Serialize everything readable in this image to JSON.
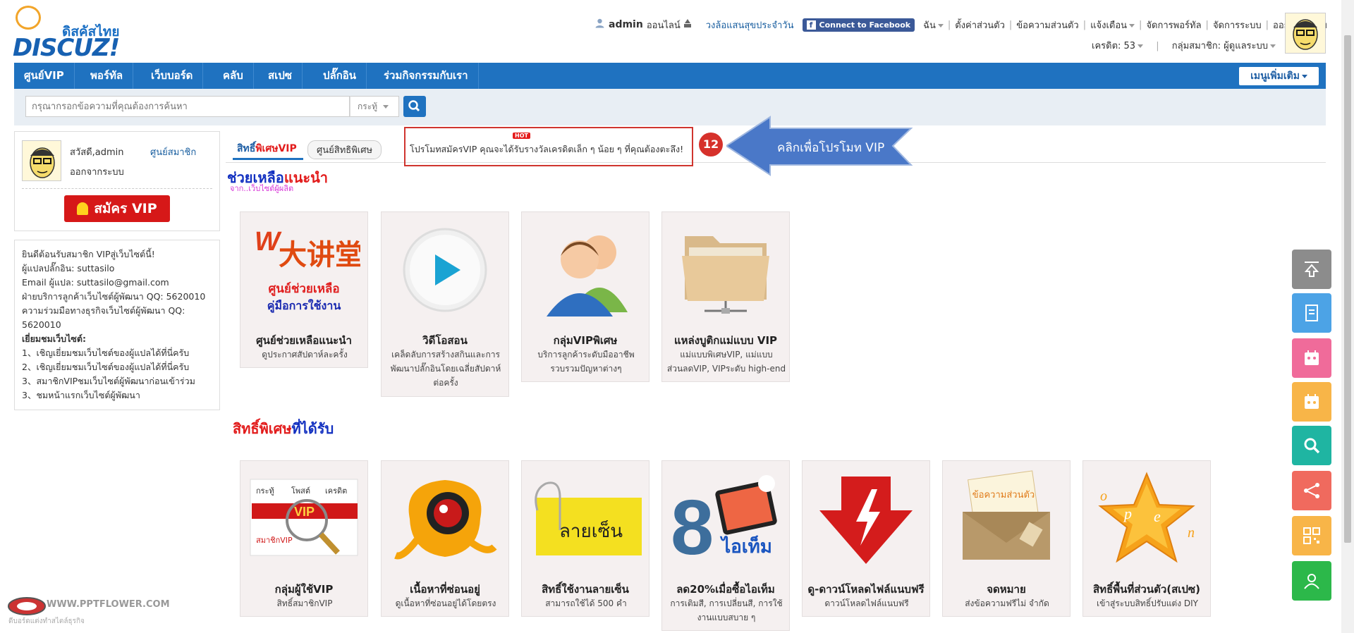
{
  "logo": {
    "thai": "ดิสคัสไทย",
    "word": "DISCUZ!"
  },
  "topbar": {
    "user": "admin",
    "status": "ออนไลน์",
    "lottery": "วงล้อแสนสุขประจำวัน",
    "facebook": "Connect to Facebook",
    "menu": [
      "ฉัน",
      "ตั้งค่าส่วนตัว",
      "ข้อความส่วนตัว",
      "แจ้งเตือน",
      "จัดการพอร์ทัล",
      "จัดการระบบ",
      "ออกจากระบบ"
    ],
    "credits": "เครดิต: 53",
    "group": "กลุ่มสมาชิก: ผู้ดูแลระบบ"
  },
  "nav": {
    "items": [
      "ศูนย์VIP",
      "พอร์ทัล",
      "เว็บบอร์ด",
      "คลับ",
      "สเปซ",
      "ปลั๊กอิน",
      "ร่วมกิจกรรมกับเรา"
    ],
    "more": "เมนูเพิ่มเติม"
  },
  "search": {
    "placeholder": "กรุณากรอกข้อความที่คุณต้องการค้นหา",
    "scope": "กระทู้"
  },
  "user_box": {
    "greeting": "สวัสดี,admin",
    "vip_center": "ศูนย์สมาชิก",
    "logout": "ออกจากระบบ",
    "vip_button": "สมัคร VIP"
  },
  "info": {
    "lines": [
      "ยินดีต้อนรับสมาชิก VIPสู่เว็บไซต์นี้!",
      "ผู้แปลปลั๊กอิน: suttasilo",
      "Email ผู้แปล: suttasilo@gmail.com",
      "ฝ่ายบริการลูกค้าเว็บไซต์ผู้พัฒนา QQ: 5620010",
      "ความร่วมมือทางธุรกิจเว็บไซต์ผู้พัฒนา QQ: 5620010"
    ],
    "visit_heading": "เยี่ยมชมเว็บไซต์:",
    "visit_items": [
      "1、เชิญเยี่ยมชมเว็บไซต์ของผู้แปลได้ที่นี่ครับ",
      "2、เชิญเยี่ยมชมเว็บไซต์ของผู้แปลได้ที่นี่ครับ",
      "3、สมาชิกVIPชมเว็บไซต์ผู้พัฒนาก่อนเข้าร่วม",
      "3、ชมหน้าแรกเว็บไซต์ผู้พัฒนา"
    ]
  },
  "tabs": {
    "vip_a": "สิทธิ์",
    "vip_b": "พิเศษVIP",
    "rights": "ศูนย์สิทธิพิเศษ"
  },
  "promo": {
    "badge": "HOT",
    "text": "โปรโมทสมัครVIP คุณจะได้รับรางวัลเครดิตเล็ก ๆ น้อย ๆ ที่คุณต้องตะลึง!"
  },
  "callout": {
    "step": "12",
    "text": "คลิกเพื่อโปรโมท VIP"
  },
  "section1": {
    "title_a": "ช่วยเหลือ",
    "title_b": "แนะนำ",
    "subtitle": "จาก..เว็บไซต์ผู้ผลิต",
    "cards": [
      {
        "title": "ศูนย์ช่วยเหลือแนะนำ",
        "desc": "ดูประกาศสัปดาห์ละครั้ง",
        "img_text_a": "ศูนย์ช่วยเหลือ",
        "img_text_b": "คู่มือการใช้งาน"
      },
      {
        "title": "วิดีโอสอน",
        "desc": "เคล็ดลับการสร้างสกินและการพัฒนาปลั๊กอินโดยเฉลี่ยสัปดาห์ต่อครั้ง"
      },
      {
        "title": "กลุ่มVIPพิเศษ",
        "desc": "บริการลูกค้าระดับมืออาชีพ รวบรวมปัญหาต่างๆ"
      },
      {
        "title": "แหล่งบูติกแม่แบบ VIP",
        "desc": "แม่แบบพิเศษVIP, แม่แบบส่วนลดVIP, VIPระดับ high-end"
      }
    ]
  },
  "section2": {
    "title_a": "สิทธิ์พิเศษ",
    "title_b": "ที่ได้รับ",
    "cards": [
      {
        "title": "กลุ่มผู้ใช้VIP",
        "desc": "สิทธิ์สมาชิกVIP"
      },
      {
        "title": "เนื้อหาที่ซ่อนอยู่",
        "desc": "ดูเนื้อหาที่ซ่อนอยู่ได้โดยตรง"
      },
      {
        "title": "สิทธิ์ใช้งานลายเซ็น",
        "desc": "สามารถใช้ได้ 500 คำ",
        "img_text": "ลายเซ็น"
      },
      {
        "title": "ลด20%เมื่อซื้อไอเท็ม",
        "desc": "การเติมสี, การเปลี่ยนสี, การใช้งานแบบสบาย ๆ",
        "img_text": "ไอเท็ม"
      },
      {
        "title": "ดู-ดาวน์โหลดไฟล์แนบฟรี",
        "desc": "ดาวน์โหลดไฟล์แนบฟรี"
      },
      {
        "title": "จดหมาย",
        "desc": "ส่งข้อความฟรีไม่ จำกัด",
        "img_text": "ข้อความส่วนตัว"
      },
      {
        "title": "สิทธิ์พื้นที่ส่วนตัว(สเปซ)",
        "desc": "เข้าสู่ระบบสิทธิ์ปรับแต่ง DIY"
      }
    ]
  },
  "card_icon_texts": {
    "vip_card_labels": [
      "กระทู้",
      "โพสต์",
      "เครดิต"
    ],
    "vip_card_tag": "สมาชิกVIP"
  },
  "watermark": {
    "title": "WWW.PPTFLOWER.COM",
    "subtitle": "ดีบอร์ดแต่งทำสไตล์ธุรกิจ"
  },
  "colors": {
    "nav": "#1f72c0",
    "vip_button": "#d61818",
    "callout": "#4a78c8",
    "promo_border": "#d0352f"
  }
}
